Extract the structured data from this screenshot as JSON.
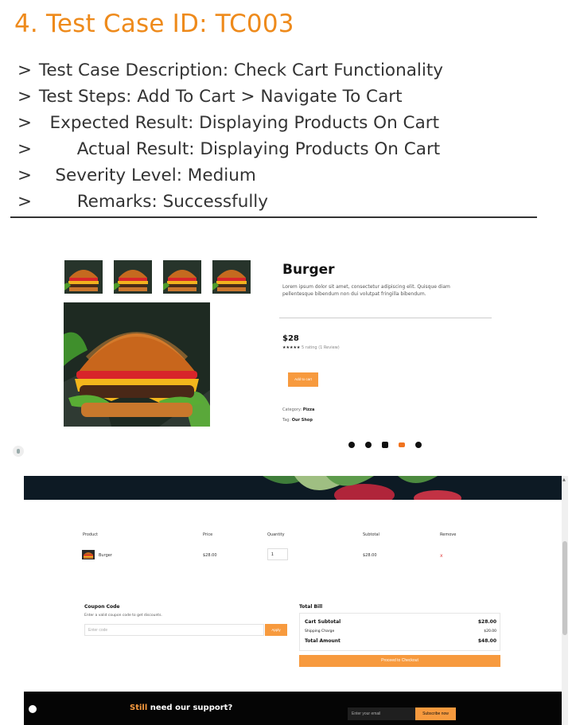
{
  "slide": {
    "title": "4. Test Case ID: TC003",
    "bullet_symbol": ">",
    "lines": [
      "Test Case Description: Check Cart Functionality",
      "Test Steps: Add To Cart > Navigate To Cart",
      "Expected Result: Displaying Products On Cart",
      "Actual Result: Displaying Products On Cart",
      "Severity Level: Medium",
      "Remarks: Successfully"
    ]
  },
  "product": {
    "name": "Burger",
    "description": "Lorem ipsum dolor sit amet, consectetur adipiscing elit. Quisque diam pellentesque bibendum non dui volutpat fringilla bibendum.",
    "price": "$28",
    "stars": "★★★★★",
    "rating_text": "5 rating",
    "reviews_text": "(1 Review)",
    "add_to_cart_label": "Add to cart",
    "category_label": "Category:",
    "category_value": "Pizza",
    "tag_label": "Tag:",
    "tag_value": "Our Shop",
    "social_icons": [
      "facebook-icon",
      "twitter-icon",
      "instagram-icon",
      "youtube-icon",
      "pinterest-icon"
    ]
  },
  "cart": {
    "headers": {
      "product": "Product",
      "price": "Price",
      "quantity": "Quantity",
      "subtotal": "Subtotal",
      "remove": "Remove"
    },
    "item": {
      "name": "Burger",
      "price": "$28.00",
      "quantity": "1",
      "subtotal": "$28.00",
      "remove": "x"
    },
    "coupon": {
      "title": "Coupon Code",
      "help": "Enter a valid coupon code to get discounts.",
      "placeholder": "Enter code",
      "apply_label": "Apply"
    },
    "bill": {
      "title": "Total Bill",
      "rows": [
        {
          "label": "Cart Subtotal",
          "value": "$28.00"
        },
        {
          "label": "Shipping Charge",
          "value": "$20.00"
        },
        {
          "label": "Total Amount",
          "value": "$48.00"
        }
      ],
      "checkout_label": "Proceed to Checkout"
    },
    "footer": {
      "support_accent": "Still",
      "support_rest": " need our support?",
      "email_placeholder": "Enter your email",
      "subscribe_label": "Subscribe now"
    }
  },
  "colors": {
    "title_orange": "#ee8a1b",
    "accent_orange": "#f79a3e",
    "banner_dark": "#0d1a24"
  }
}
